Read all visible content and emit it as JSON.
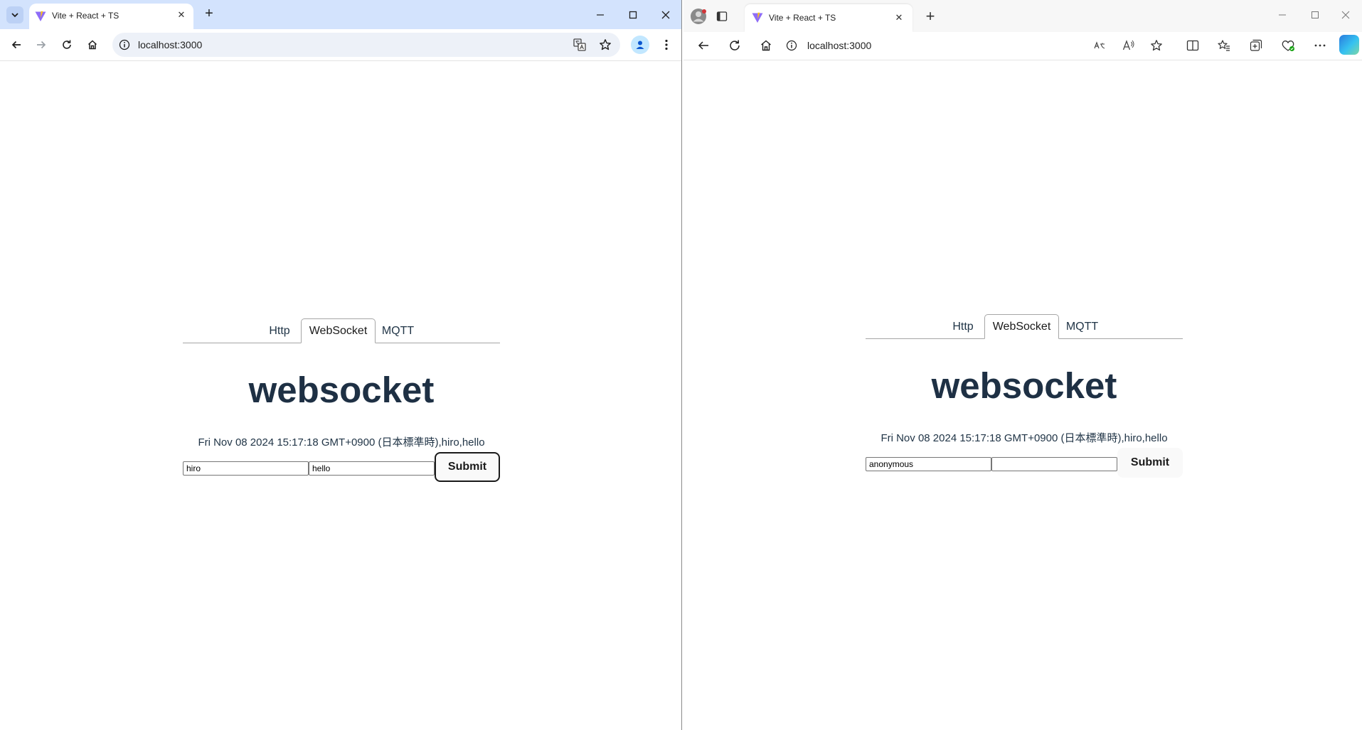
{
  "chrome": {
    "tab_title": "Vite + React + TS",
    "url": "localhost:3000"
  },
  "edge": {
    "tab_title": "Vite + React + TS",
    "url": "localhost:3000"
  },
  "left_app": {
    "tabs": [
      "Http",
      "WebSocket",
      "MQTT"
    ],
    "active_tab": "WebSocket",
    "heading": "websocket",
    "message": "Fri Nov 08 2024 15:17:18 GMT+0900 (日本標準時),hiro,hello",
    "name_value": "hiro",
    "text_value": "hello",
    "submit_label": "Submit"
  },
  "right_app": {
    "tabs": [
      "Http",
      "WebSocket",
      "MQTT"
    ],
    "active_tab": "WebSocket",
    "heading": "websocket",
    "message": "Fri Nov 08 2024 15:17:18 GMT+0900 (日本標準時),hiro,hello",
    "name_value": "anonymous",
    "text_value": "",
    "submit_label": "Submit"
  },
  "colors": {
    "chrome_tabstrip": "#d3e3fd",
    "edge_tabstrip": "#f7f7f7",
    "heading": "#1e3044"
  }
}
